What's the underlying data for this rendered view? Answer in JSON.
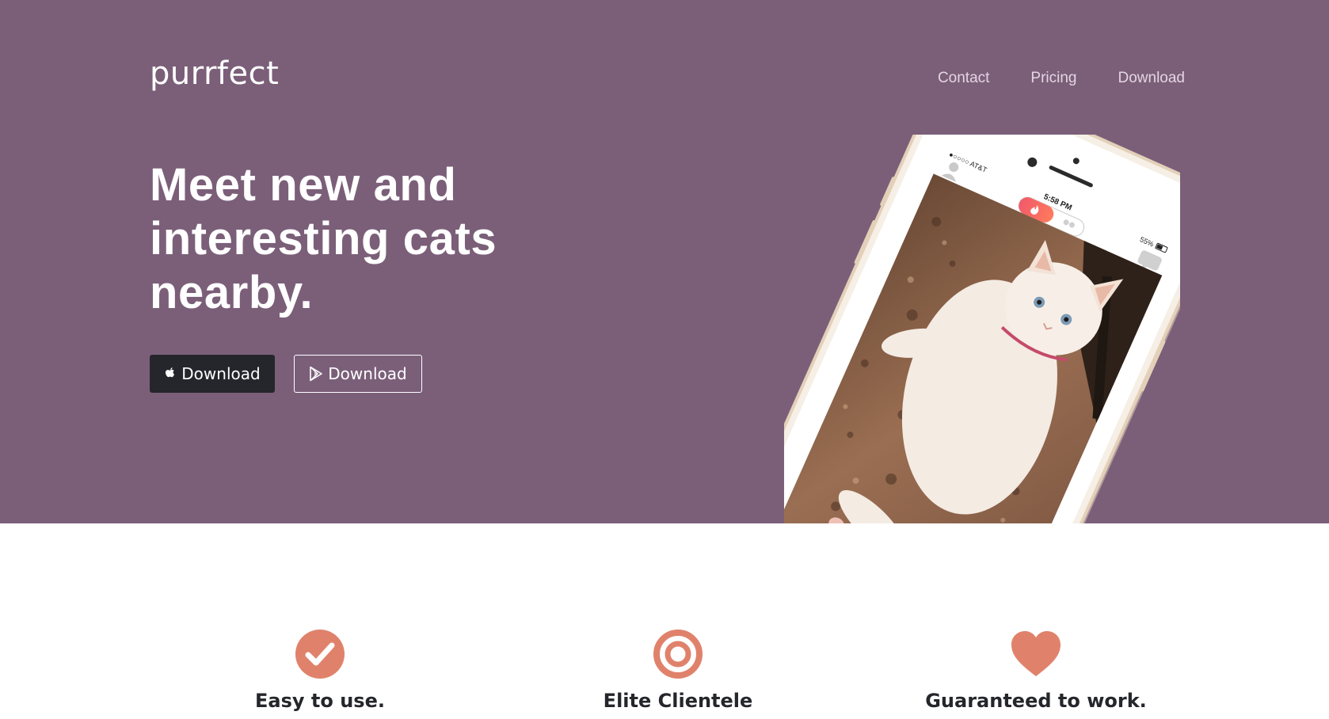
{
  "header": {
    "brand": "purrfect",
    "nav": [
      {
        "label": "Contact"
      },
      {
        "label": "Pricing"
      },
      {
        "label": "Download"
      }
    ]
  },
  "hero": {
    "headline": "Meet new and interesting cats nearby.",
    "buttons": {
      "ios_label": "Download",
      "android_label": "Download"
    },
    "phone": {
      "carrier": "●○○○○ AT&T",
      "time": "5:58 PM",
      "battery": "55%"
    }
  },
  "features": [
    {
      "title": "Easy to use.",
      "icon": "check-circle-icon"
    },
    {
      "title": "Elite Clientele",
      "icon": "target-icon"
    },
    {
      "title": "Guaranteed to work.",
      "icon": "heart-icon"
    }
  ],
  "colors": {
    "hero_bg": "#7b5f79",
    "accent": "#e0826b",
    "dark": "#24262b"
  }
}
